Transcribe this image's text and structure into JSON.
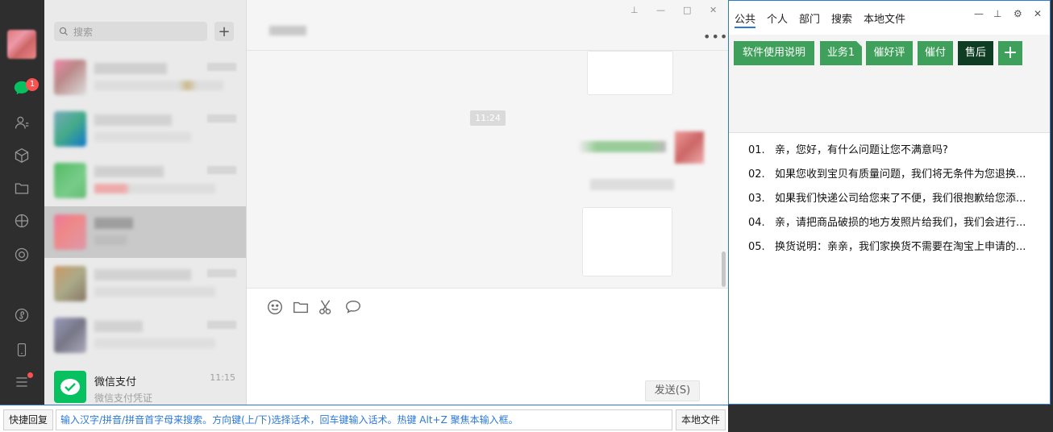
{
  "nav": {
    "unread_badge": "1",
    "icons": [
      "chat-icon",
      "contacts-icon",
      "cube-icon",
      "folder-icon",
      "moments-icon",
      "lens-icon",
      "mini-program-icon",
      "phone-icon",
      "menu-icon"
    ]
  },
  "search": {
    "placeholder": "搜索"
  },
  "chat_list": {
    "pay_item": {
      "name": "微信支付",
      "subtitle": "微信支付凭证",
      "time": "11:15"
    }
  },
  "chat": {
    "time_divider": "11:24",
    "send_label": "发送(S)"
  },
  "panel": {
    "tabs": [
      "公共",
      "个人",
      "部门",
      "搜索",
      "本地文件"
    ],
    "buttons": [
      "软件使用说明",
      "业务1",
      "催好评",
      "催付",
      "售后"
    ],
    "add_label": "+",
    "phrases": [
      {
        "no": "01.",
        "text": "亲，您好，有什么问题让您不满意吗?"
      },
      {
        "no": "02.",
        "text": "如果您收到宝贝有质量问题，我们将无条件为您退换..."
      },
      {
        "no": "03.",
        "text": "如果我们快递公司给您来了不便，我们很抱歉给您添..."
      },
      {
        "no": "04.",
        "text": "亲，请把商品破损的地方发照片给我们，我们会进行..."
      },
      {
        "no": "05.",
        "text": "换货说明：亲亲，我们家换货不需要在淘宝上申请的..."
      }
    ]
  },
  "bottom": {
    "quick_reply": "快捷回复",
    "hint": "输入汉字/拼音/拼音首字母来搜索。方向键(上/下)选择话术，回车键输入话术。热键 Alt+Z 聚焦本输入框。",
    "local_file": "本地文件"
  },
  "colors": {
    "accent": "#2b78d6",
    "green": "#3ea05a",
    "dark_green": "#0f3d24",
    "wechat": "#07c160",
    "badge": "#fa5151"
  }
}
